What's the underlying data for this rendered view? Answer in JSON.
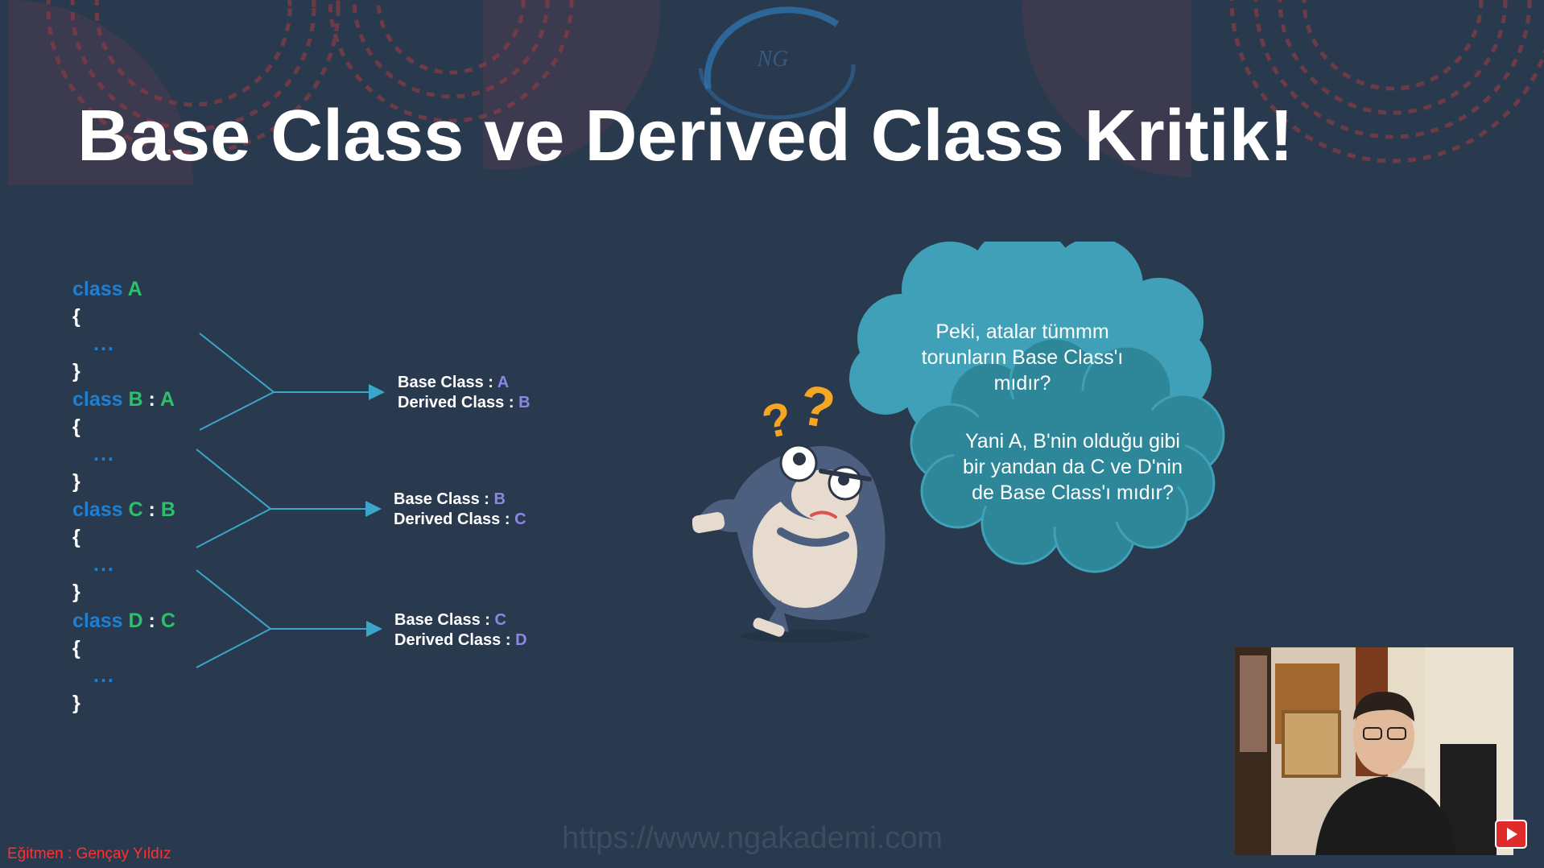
{
  "slide": {
    "title": "Base Class ve Derived Class Kritik!"
  },
  "code_blocks": [
    {
      "keyword": "class",
      "name": "A",
      "sep": "",
      "parent": "",
      "open": "{",
      "dots": "...",
      "close": "}"
    },
    {
      "keyword": "class",
      "name": "B",
      "sep": ":",
      "parent": "A",
      "open": "{",
      "dots": "...",
      "close": "}"
    },
    {
      "keyword": "class",
      "name": "C",
      "sep": ":",
      "parent": "B",
      "open": "{",
      "dots": "...",
      "close": "}"
    },
    {
      "keyword": "class",
      "name": "D",
      "sep": ":",
      "parent": "C",
      "open": "{",
      "dots": "...",
      "close": "}"
    }
  ],
  "relations": [
    {
      "base_label": "Base Class :",
      "base": "A",
      "derived_label": "Derived Class :",
      "derived": "B"
    },
    {
      "base_label": "Base Class :",
      "base": "B",
      "derived_label": "Derived Class :",
      "derived": "C"
    },
    {
      "base_label": "Base Class :",
      "base": "C",
      "derived_label": "Derived Class :",
      "derived": "D"
    }
  ],
  "bubbles": {
    "question1": "Peki, atalar tümmm torunların Base Class'ı mıdır?",
    "question2": "Yani A, B'nin olduğu gibi bir yandan da C ve D'nin de Base Class'ı mıdır?"
  },
  "footer": {
    "url": "https://www.ngakademi.com",
    "credit": "Eğitmen : Gençay Yıldız"
  },
  "icons": {
    "logo": "ngakademi-logo-icon",
    "mascot": "confused-gorilla-icon",
    "video": "youtube-play-icon"
  },
  "colors": {
    "background": "#2a3a4e",
    "keyword": "#1f7fd1",
    "class_name": "#2cc06a",
    "relation_value": "#8c86e6",
    "cloud": "#3fa0b8",
    "arrow": "#3aa6c9",
    "credit": "#ff3030"
  }
}
